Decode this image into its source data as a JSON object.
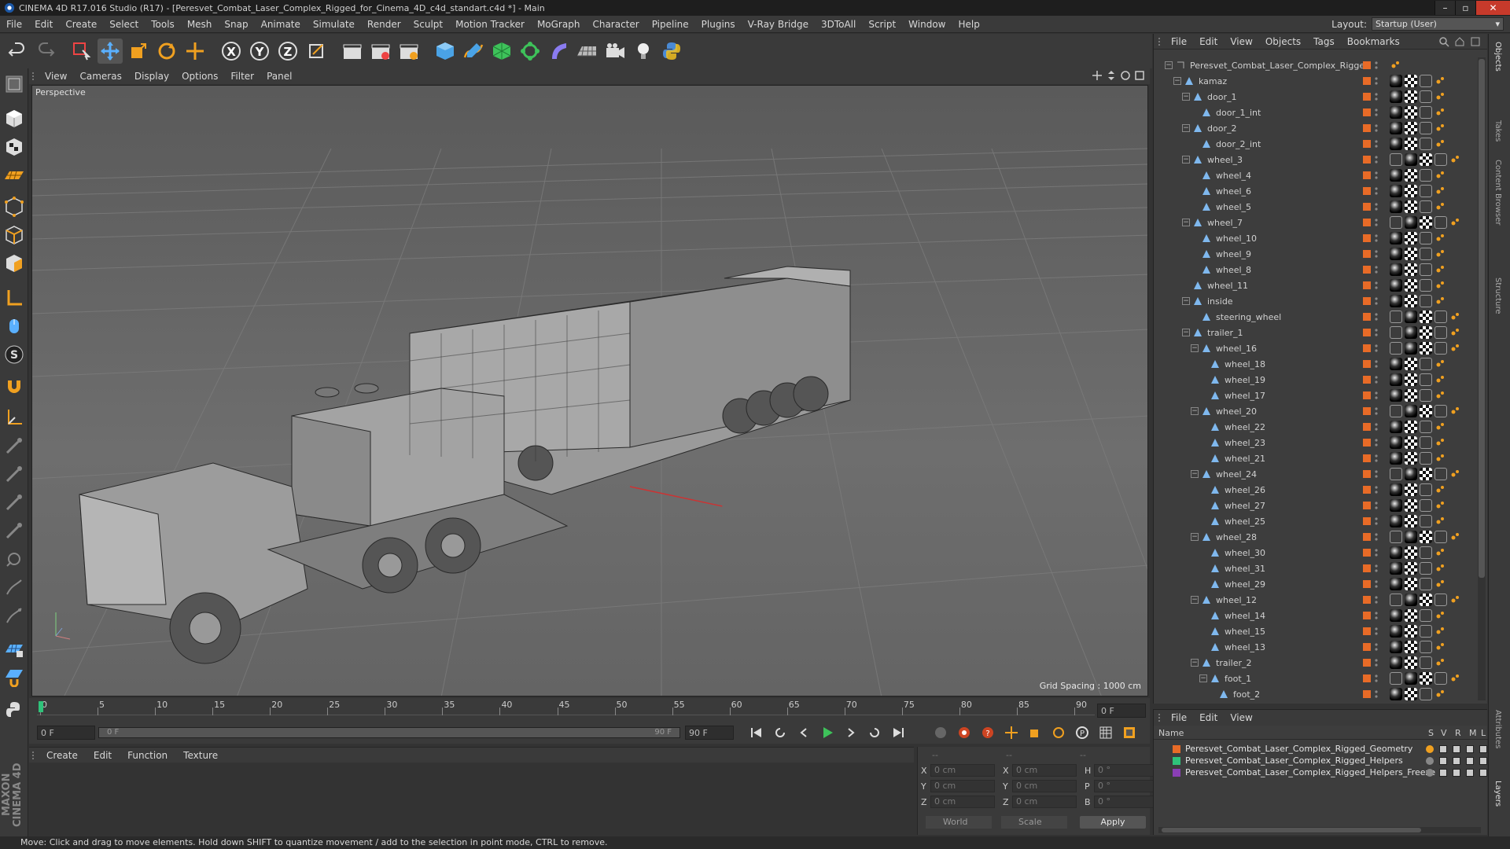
{
  "window": {
    "title": "CINEMA 4D R17.016 Studio (R17) - [Peresvet_Combat_Laser_Complex_Rigged_for_Cinema_4D_c4d_standart.c4d *] - Main",
    "min": "–",
    "max": "▫",
    "close": "✕"
  },
  "menubar": {
    "items": [
      "File",
      "Edit",
      "Create",
      "Select",
      "Tools",
      "Mesh",
      "Snap",
      "Animate",
      "Simulate",
      "Render",
      "Sculpt",
      "Motion Tracker",
      "MoGraph",
      "Character",
      "Pipeline",
      "Plugins",
      "V-Ray Bridge",
      "3DToAll",
      "Script",
      "Window",
      "Help"
    ],
    "layout_label": "Layout:",
    "layout_value": "Startup (User)"
  },
  "toolbar": {
    "x_label": "X",
    "y_label": "Y",
    "z_label": "Z"
  },
  "viewport": {
    "menu": [
      "View",
      "Cameras",
      "Display",
      "Options",
      "Filter",
      "Panel"
    ],
    "label": "Perspective",
    "grid_spacing": "Grid Spacing : 1000 cm"
  },
  "timeline": {
    "ticks": [
      "0",
      "5",
      "10",
      "15",
      "20",
      "25",
      "30",
      "35",
      "40",
      "45",
      "50",
      "55",
      "60",
      "65",
      "70",
      "75",
      "80",
      "85",
      "90"
    ],
    "current_frame_right": "0 F",
    "start_field": "0 F",
    "range_start": "0 F",
    "range_end": "90 F",
    "end_field": "90 F"
  },
  "materials": {
    "menu": [
      "Create",
      "Edit",
      "Function",
      "Texture"
    ]
  },
  "coords": {
    "header_a": "--",
    "header_b": "--",
    "header_c": "--",
    "rows": [
      {
        "a": "X",
        "av": "0 cm",
        "b": "X",
        "bv": "0 cm",
        "c": "H",
        "cv": "0 °"
      },
      {
        "a": "Y",
        "av": "0 cm",
        "b": "Y",
        "bv": "0 cm",
        "c": "P",
        "cv": "0 °"
      },
      {
        "a": "Z",
        "av": "0 cm",
        "b": "Z",
        "bv": "0 cm",
        "c": "B",
        "cv": "0 °"
      }
    ],
    "world": "World",
    "scale": "Scale",
    "apply": "Apply"
  },
  "status": "Move: Click and drag to move elements. Hold down SHIFT to quantize movement / add to the selection in point mode, CTRL to remove.",
  "objects": {
    "menu": [
      "File",
      "Edit",
      "View",
      "Objects",
      "Tags",
      "Bookmarks"
    ],
    "tree": [
      {
        "name": "Peresvet_Combat_Laser_Complex_Rigged",
        "depth": 0,
        "twist": "−",
        "icon": "null",
        "tags": []
      },
      {
        "name": "kamaz",
        "depth": 1,
        "twist": "−",
        "icon": "poly",
        "tags": [
          "mat",
          "chk",
          "ph"
        ]
      },
      {
        "name": "door_1",
        "depth": 2,
        "twist": "−",
        "icon": "poly",
        "tags": [
          "mat",
          "chk",
          "ph"
        ]
      },
      {
        "name": "door_1_int",
        "depth": 3,
        "twist": "",
        "icon": "poly",
        "tags": [
          "mat",
          "chk",
          "ph"
        ]
      },
      {
        "name": "door_2",
        "depth": 2,
        "twist": "−",
        "icon": "poly",
        "tags": [
          "mat",
          "chk",
          "ph"
        ]
      },
      {
        "name": "door_2_int",
        "depth": 3,
        "twist": "",
        "icon": "poly",
        "tags": [
          "mat",
          "chk",
          "ph"
        ]
      },
      {
        "name": "wheel_3",
        "depth": 2,
        "twist": "−",
        "icon": "poly",
        "tags": [
          "ph",
          "mat",
          "chk",
          "ph"
        ]
      },
      {
        "name": "wheel_4",
        "depth": 3,
        "twist": "",
        "icon": "poly",
        "tags": [
          "mat",
          "chk",
          "ph"
        ]
      },
      {
        "name": "wheel_6",
        "depth": 3,
        "twist": "",
        "icon": "poly",
        "tags": [
          "mat",
          "chk",
          "ph"
        ]
      },
      {
        "name": "wheel_5",
        "depth": 3,
        "twist": "",
        "icon": "poly",
        "tags": [
          "mat",
          "chk",
          "ph"
        ]
      },
      {
        "name": "wheel_7",
        "depth": 2,
        "twist": "−",
        "icon": "poly",
        "tags": [
          "ph",
          "mat",
          "chk",
          "ph"
        ]
      },
      {
        "name": "wheel_10",
        "depth": 3,
        "twist": "",
        "icon": "poly",
        "tags": [
          "mat",
          "chk",
          "ph"
        ]
      },
      {
        "name": "wheel_9",
        "depth": 3,
        "twist": "",
        "icon": "poly",
        "tags": [
          "mat",
          "chk",
          "ph"
        ]
      },
      {
        "name": "wheel_8",
        "depth": 3,
        "twist": "",
        "icon": "poly",
        "tags": [
          "mat",
          "chk",
          "ph"
        ]
      },
      {
        "name": "wheel_11",
        "depth": 2,
        "twist": "",
        "icon": "poly",
        "tags": [
          "mat",
          "chk",
          "ph"
        ]
      },
      {
        "name": "inside",
        "depth": 2,
        "twist": "−",
        "icon": "poly",
        "tags": [
          "mat",
          "chk",
          "ph"
        ]
      },
      {
        "name": "steering_wheel",
        "depth": 3,
        "twist": "",
        "icon": "poly",
        "tags": [
          "ph",
          "mat",
          "chk",
          "ph"
        ]
      },
      {
        "name": "trailer_1",
        "depth": 2,
        "twist": "−",
        "icon": "poly",
        "tags": [
          "ph",
          "mat",
          "chk",
          "ph"
        ]
      },
      {
        "name": "wheel_16",
        "depth": 3,
        "twist": "−",
        "icon": "poly",
        "tags": [
          "ph",
          "mat",
          "chk",
          "ph"
        ]
      },
      {
        "name": "wheel_18",
        "depth": 4,
        "twist": "",
        "icon": "poly",
        "tags": [
          "mat",
          "chk",
          "ph"
        ]
      },
      {
        "name": "wheel_19",
        "depth": 4,
        "twist": "",
        "icon": "poly",
        "tags": [
          "mat",
          "chk",
          "ph"
        ]
      },
      {
        "name": "wheel_17",
        "depth": 4,
        "twist": "",
        "icon": "poly",
        "tags": [
          "mat",
          "chk",
          "ph"
        ]
      },
      {
        "name": "wheel_20",
        "depth": 3,
        "twist": "−",
        "icon": "poly",
        "tags": [
          "ph",
          "mat",
          "chk",
          "ph"
        ]
      },
      {
        "name": "wheel_22",
        "depth": 4,
        "twist": "",
        "icon": "poly",
        "tags": [
          "mat",
          "chk",
          "ph"
        ]
      },
      {
        "name": "wheel_23",
        "depth": 4,
        "twist": "",
        "icon": "poly",
        "tags": [
          "mat",
          "chk",
          "ph"
        ]
      },
      {
        "name": "wheel_21",
        "depth": 4,
        "twist": "",
        "icon": "poly",
        "tags": [
          "mat",
          "chk",
          "ph"
        ]
      },
      {
        "name": "wheel_24",
        "depth": 3,
        "twist": "−",
        "icon": "poly",
        "tags": [
          "ph",
          "mat",
          "chk",
          "ph"
        ]
      },
      {
        "name": "wheel_26",
        "depth": 4,
        "twist": "",
        "icon": "poly",
        "tags": [
          "mat",
          "chk",
          "ph"
        ]
      },
      {
        "name": "wheel_27",
        "depth": 4,
        "twist": "",
        "icon": "poly",
        "tags": [
          "mat",
          "chk",
          "ph"
        ]
      },
      {
        "name": "wheel_25",
        "depth": 4,
        "twist": "",
        "icon": "poly",
        "tags": [
          "mat",
          "chk",
          "ph"
        ]
      },
      {
        "name": "wheel_28",
        "depth": 3,
        "twist": "−",
        "icon": "poly",
        "tags": [
          "ph",
          "mat",
          "chk",
          "ph"
        ]
      },
      {
        "name": "wheel_30",
        "depth": 4,
        "twist": "",
        "icon": "poly",
        "tags": [
          "mat",
          "chk",
          "ph"
        ]
      },
      {
        "name": "wheel_31",
        "depth": 4,
        "twist": "",
        "icon": "poly",
        "tags": [
          "mat",
          "chk",
          "ph"
        ]
      },
      {
        "name": "wheel_29",
        "depth": 4,
        "twist": "",
        "icon": "poly",
        "tags": [
          "mat",
          "chk",
          "ph"
        ]
      },
      {
        "name": "wheel_12",
        "depth": 3,
        "twist": "−",
        "icon": "poly",
        "tags": [
          "ph",
          "mat",
          "chk",
          "ph"
        ]
      },
      {
        "name": "wheel_14",
        "depth": 4,
        "twist": "",
        "icon": "poly",
        "tags": [
          "mat",
          "chk",
          "ph"
        ]
      },
      {
        "name": "wheel_15",
        "depth": 4,
        "twist": "",
        "icon": "poly",
        "tags": [
          "mat",
          "chk",
          "ph"
        ]
      },
      {
        "name": "wheel_13",
        "depth": 4,
        "twist": "",
        "icon": "poly",
        "tags": [
          "mat",
          "chk",
          "ph"
        ]
      },
      {
        "name": "trailer_2",
        "depth": 3,
        "twist": "−",
        "icon": "poly",
        "tags": [
          "mat",
          "chk",
          "ph"
        ]
      },
      {
        "name": "foot_1",
        "depth": 4,
        "twist": "−",
        "icon": "poly",
        "tags": [
          "ph",
          "mat",
          "chk",
          "ph"
        ]
      },
      {
        "name": "foot_2",
        "depth": 5,
        "twist": "",
        "icon": "poly",
        "tags": [
          "mat",
          "chk",
          "ph"
        ]
      }
    ]
  },
  "layers": {
    "menu": [
      "File",
      "Edit",
      "View"
    ],
    "header": {
      "name": "Name",
      "s": "S",
      "v": "V",
      "r": "R",
      "m": "M",
      "l": "L"
    },
    "rows": [
      {
        "name": "Peresvet_Combat_Laser_Complex_Rigged_Geometry",
        "color": "#e86b27"
      },
      {
        "name": "Peresvet_Combat_Laser_Complex_Rigged_Helpers",
        "color": "#2fc27a"
      },
      {
        "name": "Peresvet_Combat_Laser_Complex_Rigged_Helpers_Freeze",
        "color": "#8a3fb5"
      }
    ]
  },
  "right_tabs": [
    "Objects",
    "Takes",
    "Content Browser",
    "Structure",
    "Attributes",
    "Layers"
  ],
  "maxon": "MAXON CINEMA 4D"
}
